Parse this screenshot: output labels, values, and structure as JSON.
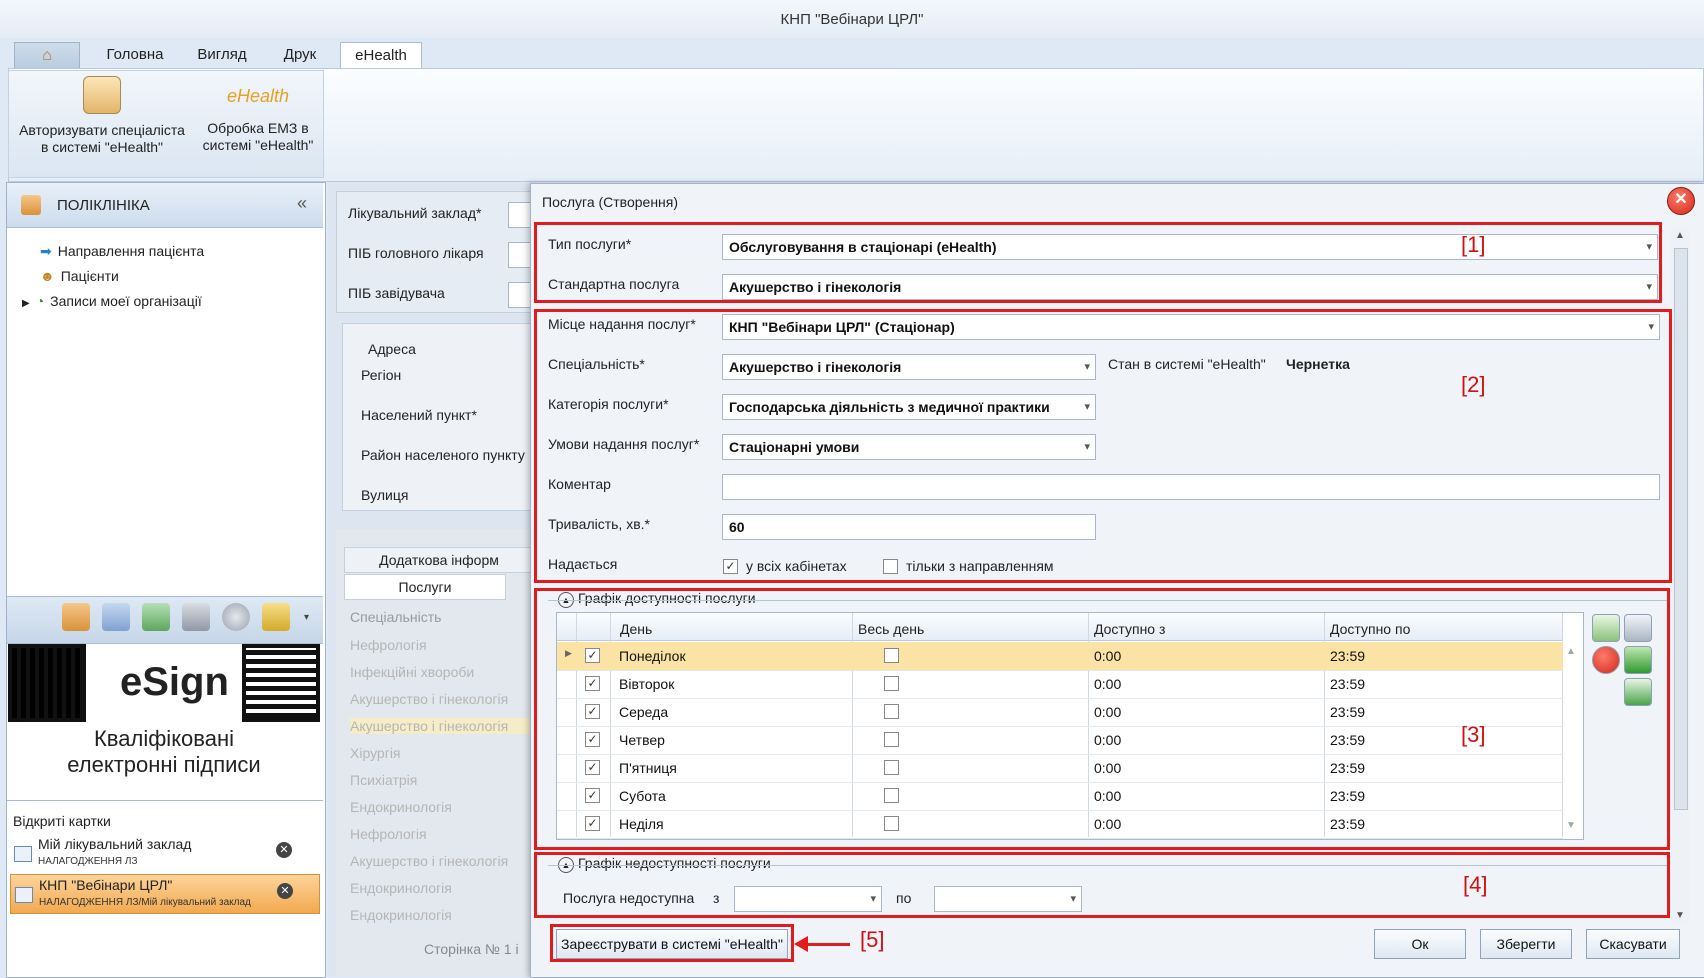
{
  "window": {
    "title": "КНП \"Вебінари ЦРЛ\""
  },
  "ribbon": {
    "tabs": [
      "Головна",
      "Вигляд",
      "Друк",
      "eHealth"
    ],
    "buttons": [
      {
        "line1": "Авторизувати спеціаліста",
        "line2": "в системі \"eHealth\""
      },
      {
        "line1": "Обробка ЕМЗ в",
        "line2": "системі \"eHealth\""
      }
    ]
  },
  "sidebar": {
    "title": "ПОЛІКЛІНІКА",
    "items": [
      "Направлення пацієнта",
      "Пацієнти",
      "Записи моеї організації"
    ],
    "esign_brand": "eSign",
    "esign_text1": "Кваліфіковані",
    "esign_text2": "електронні підписи",
    "open_cards_title": "Відкриті картки",
    "cards": [
      {
        "name": "Мій лікувальний заклад",
        "sub": "НАЛАГОДЖЕННЯ ЛЗ"
      },
      {
        "name": "КНП \"Вебінари ЦРЛ\"",
        "sub": "НАЛАГОДЖЕННЯ ЛЗ/Мій лікувальний заклад"
      }
    ]
  },
  "background_form": {
    "labels": [
      "Лікувальний заклад*",
      "ПІБ головного лікаря",
      "ПІБ завідувача"
    ],
    "address_group": "Адреса",
    "address_labels": [
      "Регіон",
      "Населений пункт*",
      "Район населеного пункту",
      "Вулиця"
    ],
    "tab_extra": "Додаткова інформ",
    "tab_services": "Послуги",
    "column": "Спеціальність",
    "rows": [
      "Нефрологія",
      "Інфекційні хвороби",
      "Акушерство і гінекологія",
      "Акушерство і гінекологія",
      "Хірургія",
      "Психіатрія",
      "Ендокринологія",
      "Нефрологія",
      "Акушерство і гінекологія",
      "Ендокринологія",
      "Ендокринологія"
    ],
    "pager": "Сторінка № 1 і"
  },
  "dialog": {
    "title": "Послуга (Створення)",
    "service_type_label": "Тип послуги*",
    "service_type": "Обслуговування в стаціонарі (eHealth)",
    "standard_service_label": "Стандартна послуга",
    "standard_service": "Акушерство і гінекологія",
    "place_label": "Місце надання послуг*",
    "place": "КНП \"Вебінари ЦРЛ\" (Стаціонар)",
    "specialty_label": "Спеціальність*",
    "specialty": "Акушерство і гінекологія",
    "ehealth_state_label": "Стан в системі \"eHealth\"",
    "ehealth_state": "Чернетка",
    "category_label": "Категорія послуги*",
    "category": "Господарська діяльність з медичної практики",
    "conditions_label": "Умови надання послуг*",
    "conditions": "Стаціонарні умови",
    "comment_label": "Коментар",
    "comment": "",
    "duration_label": "Тривалість, хв.*",
    "duration": "60",
    "provided_label": "Надається",
    "all_cabinets_label": "у всіх кабінетах",
    "only_referral_label": "тільки з направленням",
    "availability_title": "Графік доступності послуги",
    "grid_headers": [
      "День",
      "Весь день",
      "Доступно з",
      "Доступно по"
    ],
    "schedule": [
      {
        "day": "Понеділок",
        "from": "0:00",
        "to": "23:59"
      },
      {
        "day": "Вівторок",
        "from": "0:00",
        "to": "23:59"
      },
      {
        "day": "Середа",
        "from": "0:00",
        "to": "23:59"
      },
      {
        "day": "Четвер",
        "from": "0:00",
        "to": "23:59"
      },
      {
        "day": "П'ятниця",
        "from": "0:00",
        "to": "23:59"
      },
      {
        "day": "Субота",
        "from": "0:00",
        "to": "23:59"
      },
      {
        "day": "Неділя",
        "from": "0:00",
        "to": "23:59"
      }
    ],
    "unavailability_title": "Графік недоступності послуги",
    "unavailable_label": "Послуга недоступна",
    "from_label": "з",
    "to_label": "по",
    "register_button": "Зареєструвати в системі \"eHealth\"",
    "ok_button": "Ок",
    "save_button": "Зберегти",
    "cancel_button": "Скасувати"
  },
  "annotations": [
    "[1]",
    "[2]",
    "[3]",
    "[4]",
    "[5]"
  ],
  "colors": {
    "highlight_red": "#e01c1c",
    "selected_row": "#fbe3a6",
    "ribbon": "#dfe9f5"
  }
}
